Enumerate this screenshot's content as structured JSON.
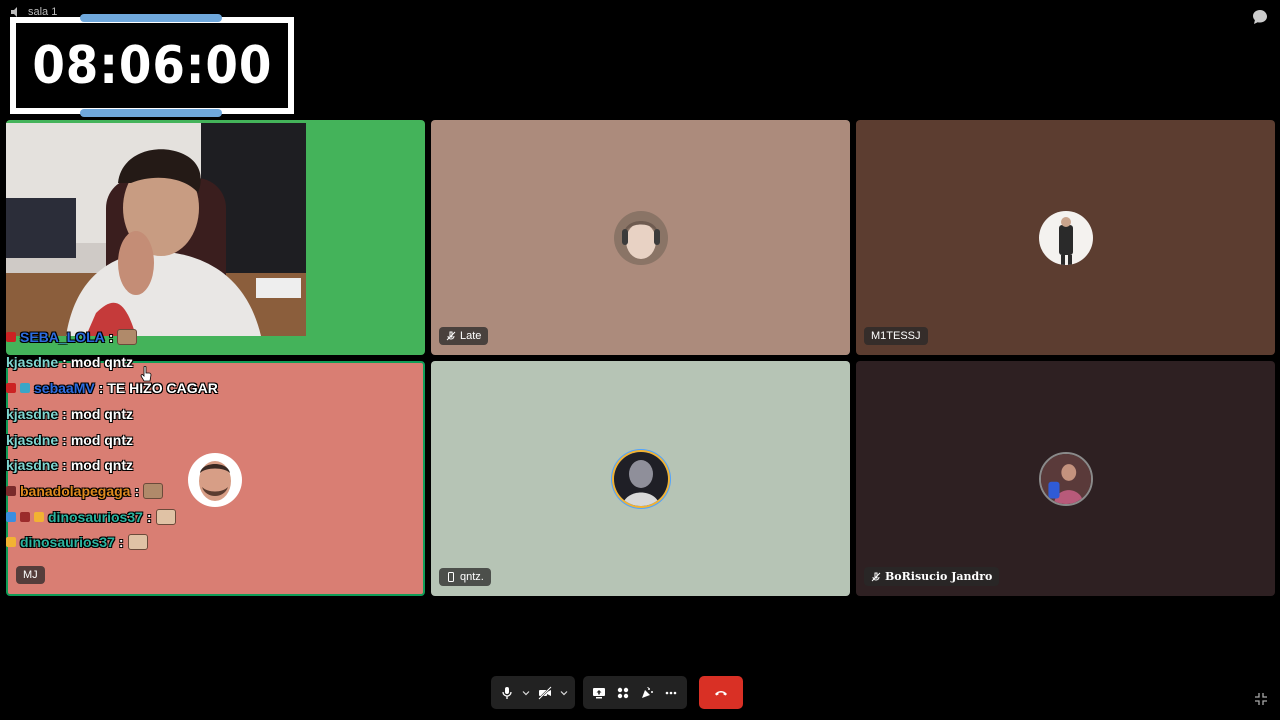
{
  "window": {
    "room_label": "sala 1"
  },
  "timer": {
    "value": "08:06:00"
  },
  "participants": [
    {
      "name": "",
      "tile": "webcam-self"
    },
    {
      "name": "Late",
      "muted": true
    },
    {
      "name": "M1TESSJ",
      "muted": false
    },
    {
      "name": "MJ",
      "muted": false
    },
    {
      "name": "qntz.",
      "device": "phone"
    },
    {
      "name": "BoRisucio Jandro",
      "muted": true
    }
  ],
  "chat": [
    {
      "user": "SEBA_LOLA",
      "sep": ":",
      "text": "",
      "user_color": "#2d6cdf"
    },
    {
      "user": "kjasdne",
      "sep": ":",
      "text": "mod qntz",
      "user_color": "#7fd6d0"
    },
    {
      "user": "sebaaMV",
      "sep": ":",
      "text": "TE HIZO CAGAR",
      "user_color": "#2d6cdf"
    },
    {
      "user": "kjasdne",
      "sep": ":",
      "text": "mod qntz",
      "user_color": "#7fd6d0"
    },
    {
      "user": "kjasdne",
      "sep": ":",
      "text": "mod qntz",
      "user_color": "#7fd6d0"
    },
    {
      "user": "kjasdne",
      "sep": ":",
      "text": "mod qntz",
      "user_color": "#7fd6d0"
    },
    {
      "user": "banadolapegaga",
      "sep": ":",
      "text": "",
      "user_color": "#e08a1f"
    },
    {
      "user": "dinosaurios37",
      "sep": ":",
      "text": "",
      "user_color": "#2cb5a0"
    },
    {
      "user": "dinosaurios37",
      "sep": ":",
      "text": "",
      "user_color": "#2cb5a0"
    }
  ],
  "toolbar": {
    "mic_icon": "microphone-icon",
    "camera_icon": "camera-off-icon",
    "share_icon": "present-screen-icon",
    "apps_icon": "apps-icon",
    "reactions_icon": "reactions-icon",
    "more_icon": "more-options-icon",
    "end_icon": "end-call-icon"
  },
  "colors": {
    "tile1": "#44b35a",
    "tile2": "#ac8b7c",
    "tile3": "#5c3d30",
    "tile4": "#d97e73",
    "tile5": "#b6c4b5",
    "tile6": "#2e2022",
    "end_call": "#d93025",
    "active_border": "#0f9d58"
  }
}
